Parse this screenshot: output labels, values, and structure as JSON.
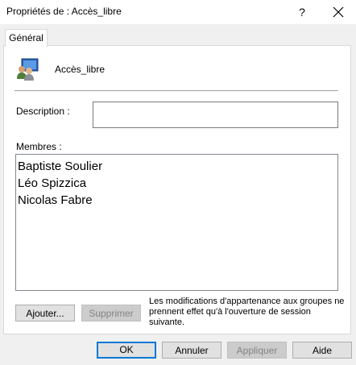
{
  "window": {
    "title": "Propriétés de : Accès_libre",
    "help_label": "?"
  },
  "tabs": [
    {
      "label": "Général",
      "active": true
    }
  ],
  "general": {
    "group_name": "Accès_libre",
    "group_icon": "users-group-icon",
    "description_label": "Description :",
    "description_value": "",
    "members_label": "Membres :",
    "members": [
      "Baptiste Soulier",
      "Léo Spizzica",
      "Nicolas Fabre"
    ],
    "add_button": "Ajouter...",
    "remove_button": "Supprimer",
    "note": "Les modifications d'appartenance aux groupes ne prennent effet qu'à l'ouverture de session suivante."
  },
  "footer": {
    "ok": "OK",
    "cancel": "Annuler",
    "apply": "Appliquer",
    "help": "Aide"
  },
  "colors": {
    "accent": "#0078d7",
    "window_bg": "#f0f0f0"
  }
}
